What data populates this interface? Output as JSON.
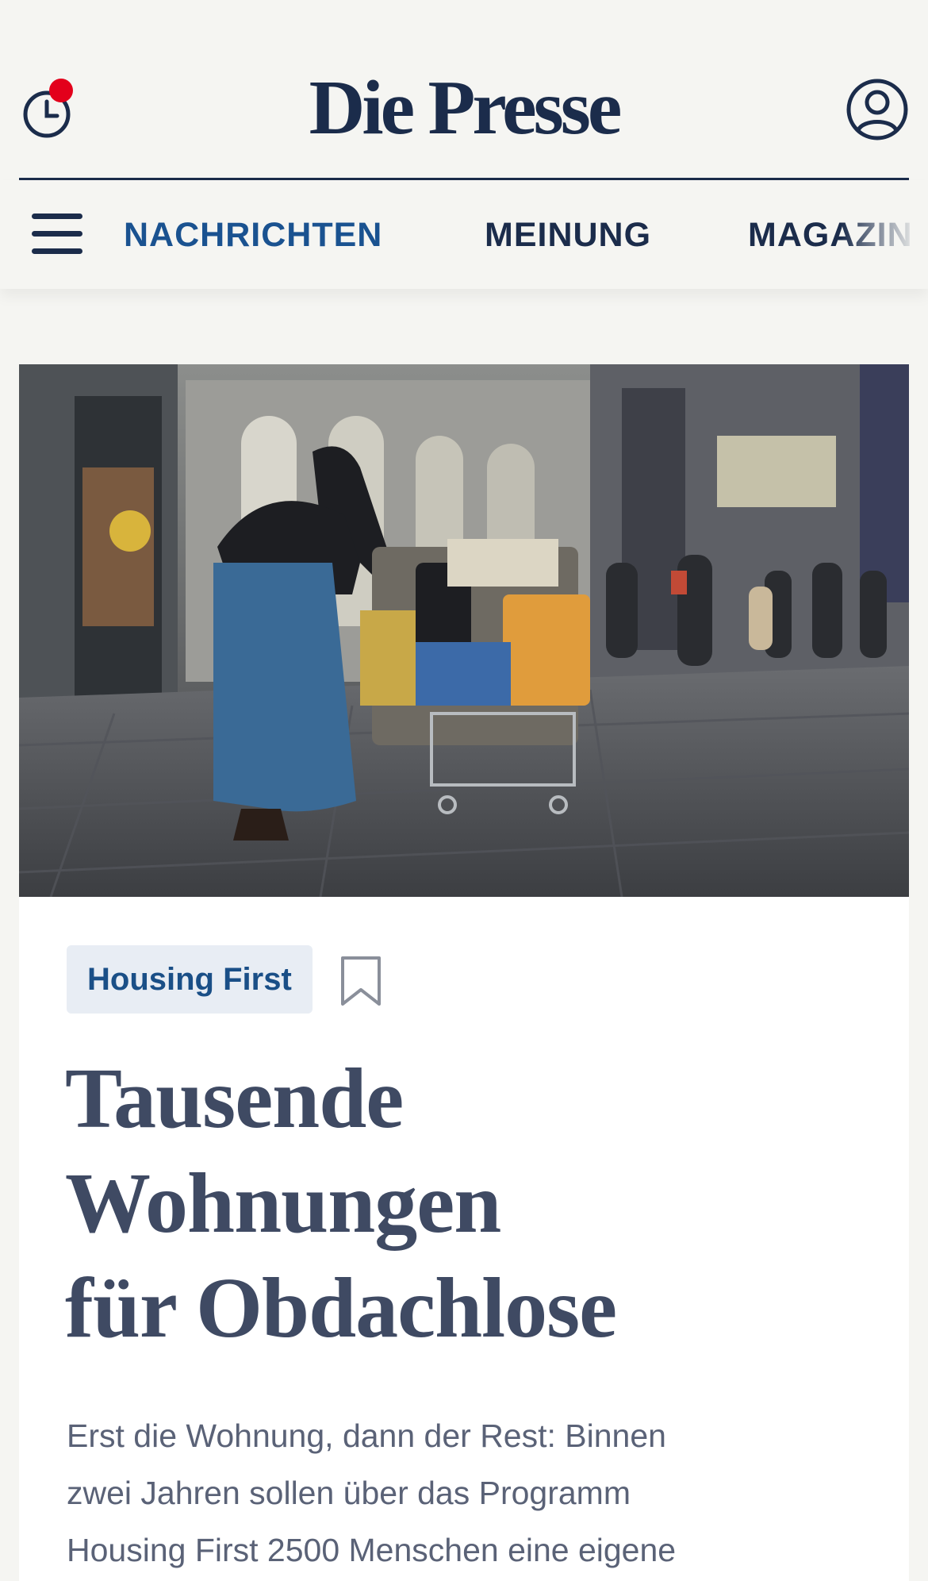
{
  "header": {
    "logo": "Die Presse",
    "history_icon": "clock-with-notification-icon",
    "account_icon": "user-account-icon",
    "notification_color": "#e3001b",
    "brand_color": "#1b2c4b"
  },
  "nav": {
    "menu_icon": "hamburger-menu-icon",
    "items": [
      {
        "label": "NACHRICHTEN",
        "active": true,
        "color": "#1a5290"
      },
      {
        "label": "MEINUNG",
        "active": false,
        "color": "#1b2c4b"
      },
      {
        "label": "MAGAZIN",
        "active": false,
        "color": "#1b2c4b"
      }
    ]
  },
  "article": {
    "image_alt": "Homeless person pushing a loaded shopping cart on a pedestrian street",
    "tag": "Housing First",
    "bookmark_icon": "bookmark-outline-icon",
    "headline_lines": [
      "Tausende",
      "Wohnungen",
      "für Obdachlose"
    ],
    "lead_lines": [
      "Erst die Wohnung, dann der Rest: Binnen",
      "zwei Jahren sollen über das Programm",
      "Housing First 2500 Menschen eine eigene"
    ]
  }
}
